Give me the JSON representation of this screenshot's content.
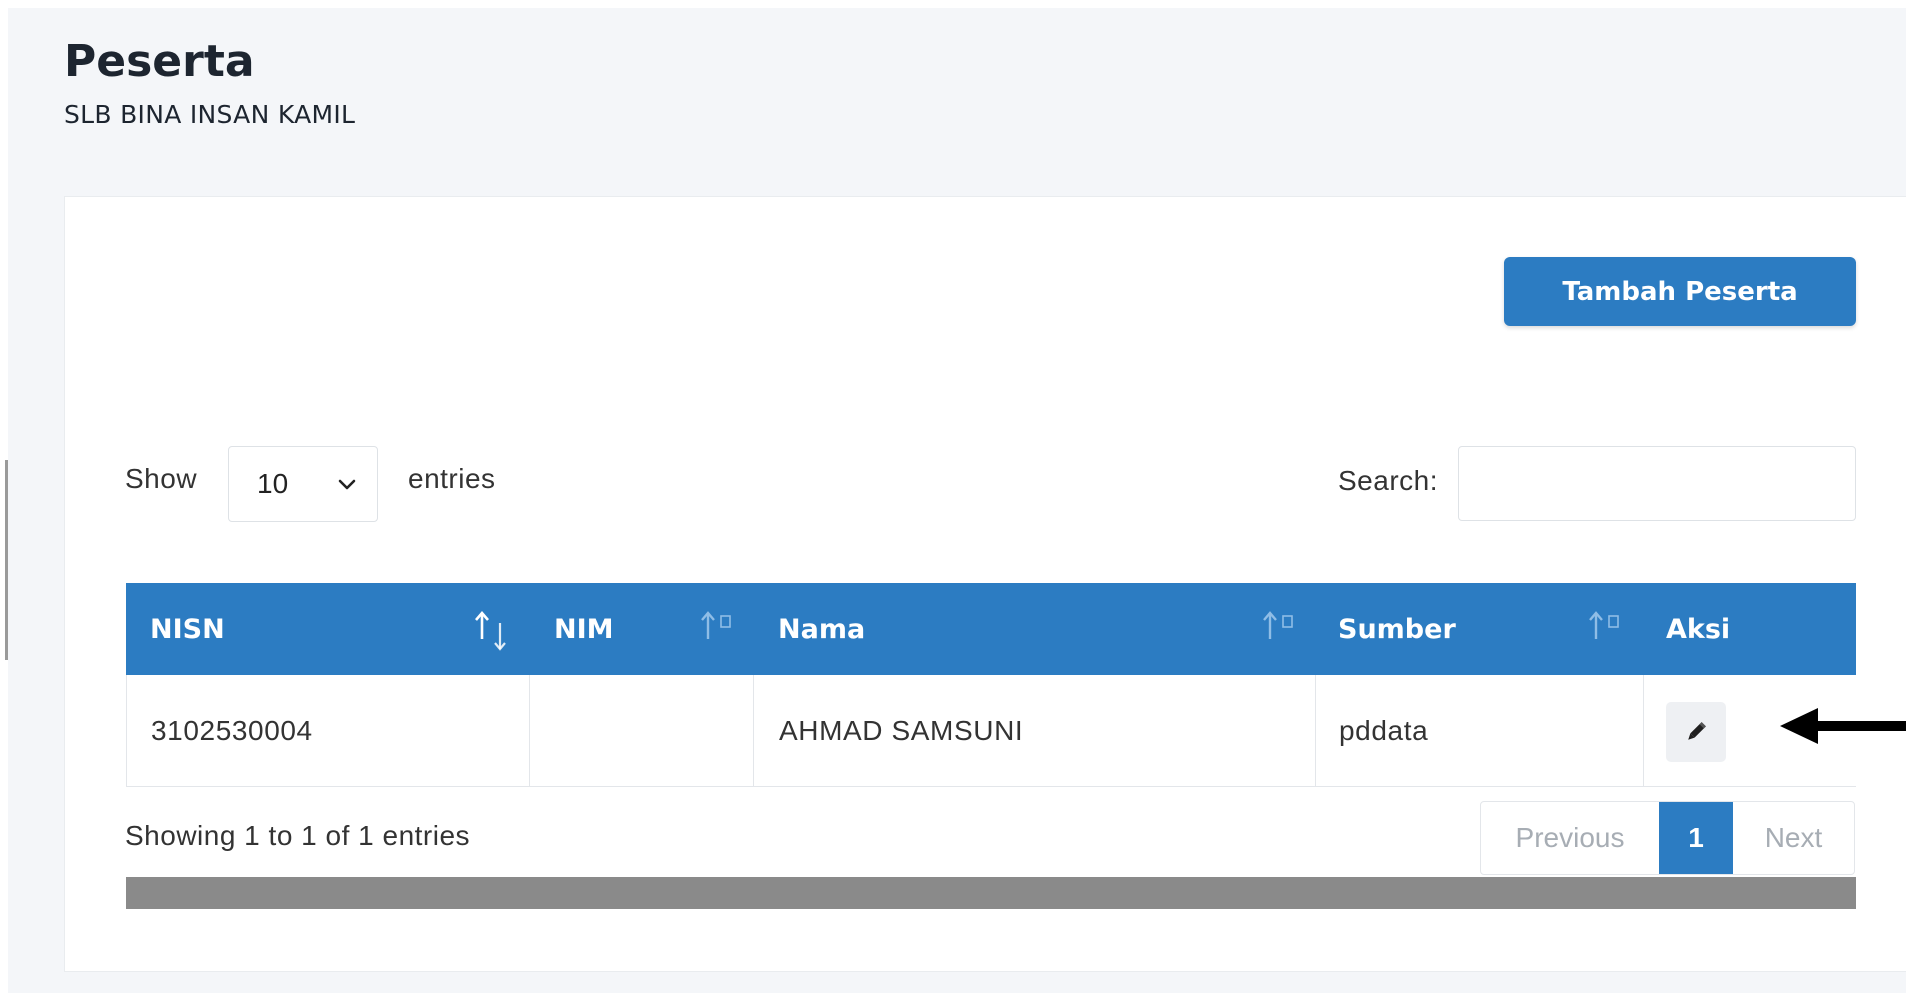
{
  "header": {
    "title": "Peserta",
    "subtitle": "SLB BINA INSAN KAMIL"
  },
  "toolbar": {
    "add_label": "Tambah Peserta"
  },
  "length_control": {
    "show_label": "Show",
    "selected": "10",
    "entries_label": "entries"
  },
  "search": {
    "label": "Search:",
    "value": ""
  },
  "table": {
    "columns": [
      "NISN",
      "NIM",
      "Nama",
      "Sumber",
      "Aksi"
    ],
    "rows": [
      {
        "nisn": "3102530004",
        "nim": "",
        "nama": "AHMAD SAMSUNI",
        "sumber": "pddata",
        "action_icon": "pencil-icon"
      }
    ]
  },
  "footer": {
    "info": "Showing 1 to 1 of 1 entries",
    "pagination": {
      "previous": "Previous",
      "current": "1",
      "next": "Next"
    }
  },
  "colors": {
    "primary": "#2c7cc2",
    "background": "#f4f6f9"
  }
}
